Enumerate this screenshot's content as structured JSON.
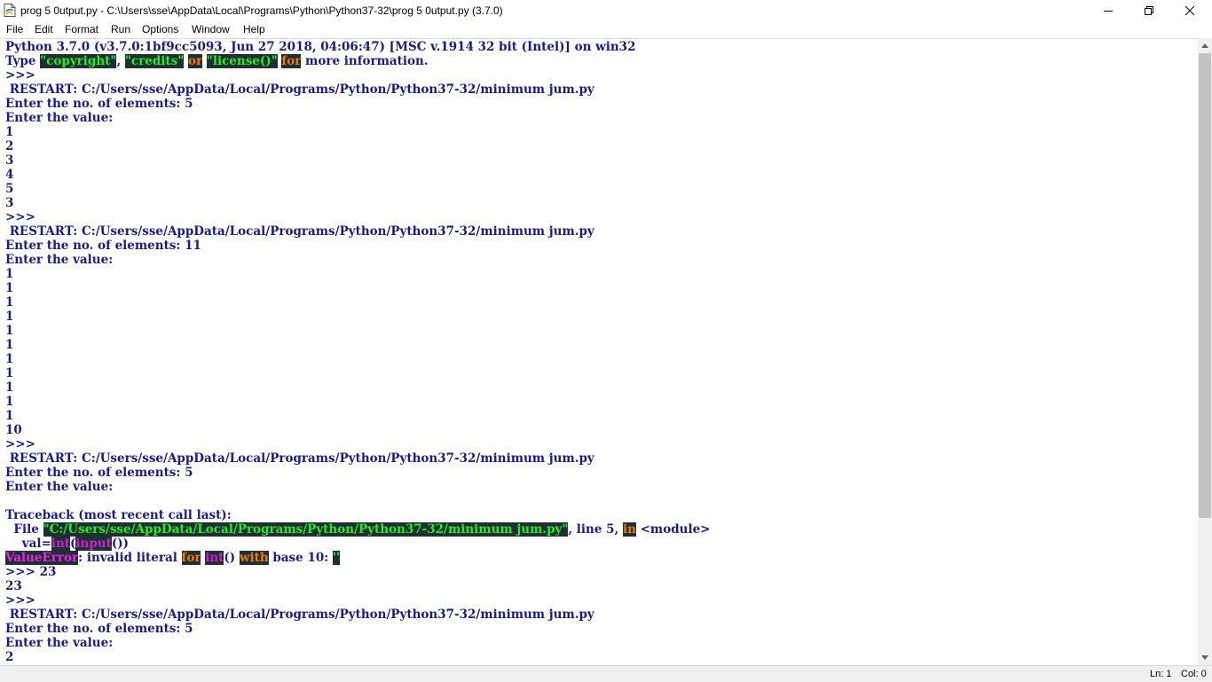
{
  "window": {
    "title": "prog 5 0utput.py - C:\\Users\\sse\\AppData\\Local\\Programs\\Python\\Python37-32\\prog 5 0utput.py (3.7.0)",
    "controls": [
      "minimize-icon",
      "restore-icon",
      "close-icon"
    ]
  },
  "menu": {
    "file": "File",
    "edit": "Edit",
    "format": "Format",
    "run": "Run",
    "options": "Options",
    "window": "Window",
    "help": "Help"
  },
  "shell": {
    "lines": [
      [
        {
          "t": "Python 3.7.0 (v3.7.0:1bf9cc5093, Jun 27 2018, 04:06:47) [MSC v.1914 32 bit (Intel)] on win32"
        }
      ],
      [
        {
          "t": "Type "
        },
        {
          "t": "\"copyright\"",
          "c": "s"
        },
        {
          "t": ", "
        },
        {
          "t": "\"credits\"",
          "c": "s"
        },
        {
          "t": " "
        },
        {
          "t": "or",
          "c": "k"
        },
        {
          "t": " "
        },
        {
          "t": "\"license()\"",
          "c": "s"
        },
        {
          "t": " "
        },
        {
          "t": "for",
          "c": "k"
        },
        {
          "t": " more information."
        }
      ],
      [
        {
          "t": ">>> "
        }
      ],
      [
        {
          "t": " RESTART: C:/Users/sse/AppData/Local/Programs/Python/Python37-32/minimum jum.py"
        }
      ],
      [
        {
          "t": "Enter the no. of elements: 5"
        }
      ],
      [
        {
          "t": "Enter the value:"
        }
      ],
      [
        {
          "t": "1"
        }
      ],
      [
        {
          "t": "2"
        }
      ],
      [
        {
          "t": "3"
        }
      ],
      [
        {
          "t": "4"
        }
      ],
      [
        {
          "t": "5"
        }
      ],
      [
        {
          "t": "3"
        }
      ],
      [
        {
          "t": ">>> "
        }
      ],
      [
        {
          "t": " RESTART: C:/Users/sse/AppData/Local/Programs/Python/Python37-32/minimum jum.py"
        }
      ],
      [
        {
          "t": "Enter the no. of elements: 11"
        }
      ],
      [
        {
          "t": "Enter the value:"
        }
      ],
      [
        {
          "t": "1"
        }
      ],
      [
        {
          "t": "1"
        }
      ],
      [
        {
          "t": "1"
        }
      ],
      [
        {
          "t": "1"
        }
      ],
      [
        {
          "t": "1"
        }
      ],
      [
        {
          "t": "1"
        }
      ],
      [
        {
          "t": "1"
        }
      ],
      [
        {
          "t": "1"
        }
      ],
      [
        {
          "t": "1"
        }
      ],
      [
        {
          "t": "1"
        }
      ],
      [
        {
          "t": "1"
        }
      ],
      [
        {
          "t": "10"
        }
      ],
      [
        {
          "t": ">>> "
        }
      ],
      [
        {
          "t": " RESTART: C:/Users/sse/AppData/Local/Programs/Python/Python37-32/minimum jum.py"
        }
      ],
      [
        {
          "t": "Enter the no. of elements: 5"
        }
      ],
      [
        {
          "t": "Enter the value:"
        }
      ],
      [
        {
          "t": ""
        }
      ],
      [
        {
          "t": "Traceback (most recent call last):"
        }
      ],
      [
        {
          "t": "  File "
        },
        {
          "t": "\"C:/Users/sse/AppData/Local/Programs/Python/Python37-32/minimum jum.py\"",
          "c": "s"
        },
        {
          "t": ", line 5, "
        },
        {
          "t": "in",
          "c": "k"
        },
        {
          "t": " <module>"
        }
      ],
      [
        {
          "t": "    val="
        },
        {
          "t": "int",
          "c": "b"
        },
        {
          "t": "("
        },
        {
          "t": "input",
          "c": "b"
        },
        {
          "t": "())"
        }
      ],
      [
        {
          "t": "ValueError",
          "c": "e"
        },
        {
          "t": ": invalid literal "
        },
        {
          "t": "for",
          "c": "k"
        },
        {
          "t": " "
        },
        {
          "t": "int",
          "c": "b"
        },
        {
          "t": "() "
        },
        {
          "t": "with",
          "c": "k"
        },
        {
          "t": " base 10: "
        },
        {
          "t": "''",
          "c": "s"
        }
      ],
      [
        {
          "t": ">>> 23"
        }
      ],
      [
        {
          "t": "23"
        }
      ],
      [
        {
          "t": ">>> "
        }
      ],
      [
        {
          "t": " RESTART: C:/Users/sse/AppData/Local/Programs/Python/Python37-32/minimum jum.py"
        }
      ],
      [
        {
          "t": "Enter the no. of elements: 5"
        }
      ],
      [
        {
          "t": "Enter the value:"
        }
      ],
      [
        {
          "t": "2"
        }
      ]
    ]
  },
  "status": {
    "ln": "Ln: 1",
    "col": "Col: 0"
  },
  "colors": {
    "text": "#1a1a8a",
    "string": "#22ee22",
    "keyword": "#f07a0a",
    "builtin": "#cc22cc",
    "error": "#ee22ee",
    "highlight_bg": "#1f2f33"
  }
}
